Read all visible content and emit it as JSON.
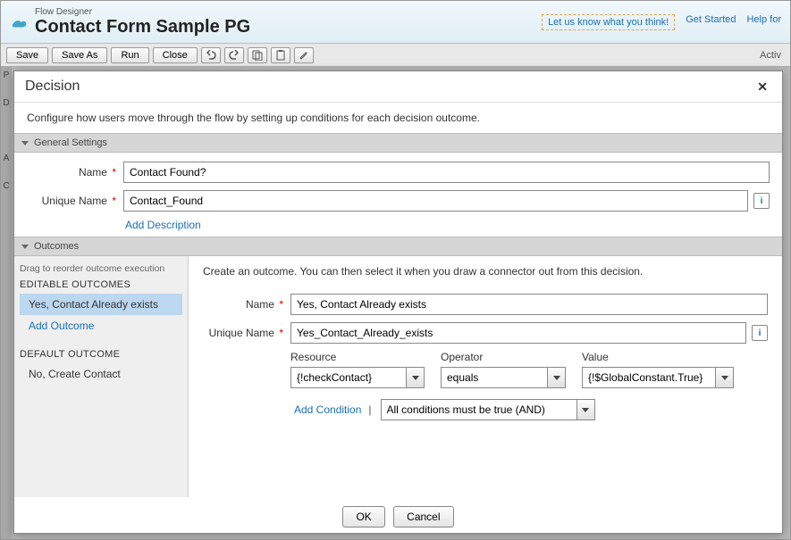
{
  "header": {
    "app_label": "Flow Designer",
    "title": "Contact Form Sample PG",
    "feedback": "Let us know what you think!",
    "get_started": "Get Started",
    "help": "Help for"
  },
  "toolbar": {
    "save": "Save",
    "save_as": "Save As",
    "run": "Run",
    "close": "Close",
    "right": "Activ"
  },
  "modal": {
    "title": "Decision",
    "desc": "Configure how users move through the flow by setting up conditions for each decision outcome."
  },
  "sections": {
    "general": "General Settings",
    "outcomes": "Outcomes"
  },
  "general": {
    "name_label": "Name",
    "name_value": "Contact Found?",
    "uname_label": "Unique Name",
    "uname_value": "Contact_Found",
    "add_desc": "Add Description"
  },
  "outcomes": {
    "hint": "Drag to reorder outcome execution",
    "editable_label": "EDITABLE OUTCOMES",
    "selected": "Yes, Contact Already exists",
    "add": "Add Outcome",
    "default_label": "DEFAULT OUTCOME",
    "default_item": "No, Create Contact"
  },
  "right": {
    "hint": "Create an outcome.  You can then select it when you draw a connector out from this decision.",
    "name_label": "Name",
    "name_value": "Yes, Contact Already exists",
    "uname_label": "Unique Name",
    "uname_value": "Yes_Contact_Already_exists",
    "resource_label": "Resource",
    "resource_value": "{!checkContact}",
    "operator_label": "Operator",
    "operator_value": "equals",
    "value_label": "Value",
    "value_value": "{!$GlobalConstant.True}",
    "add_condition": "Add Condition",
    "logic_value": "All conditions must be true (AND)"
  },
  "buttons": {
    "ok": "OK",
    "cancel": "Cancel"
  }
}
